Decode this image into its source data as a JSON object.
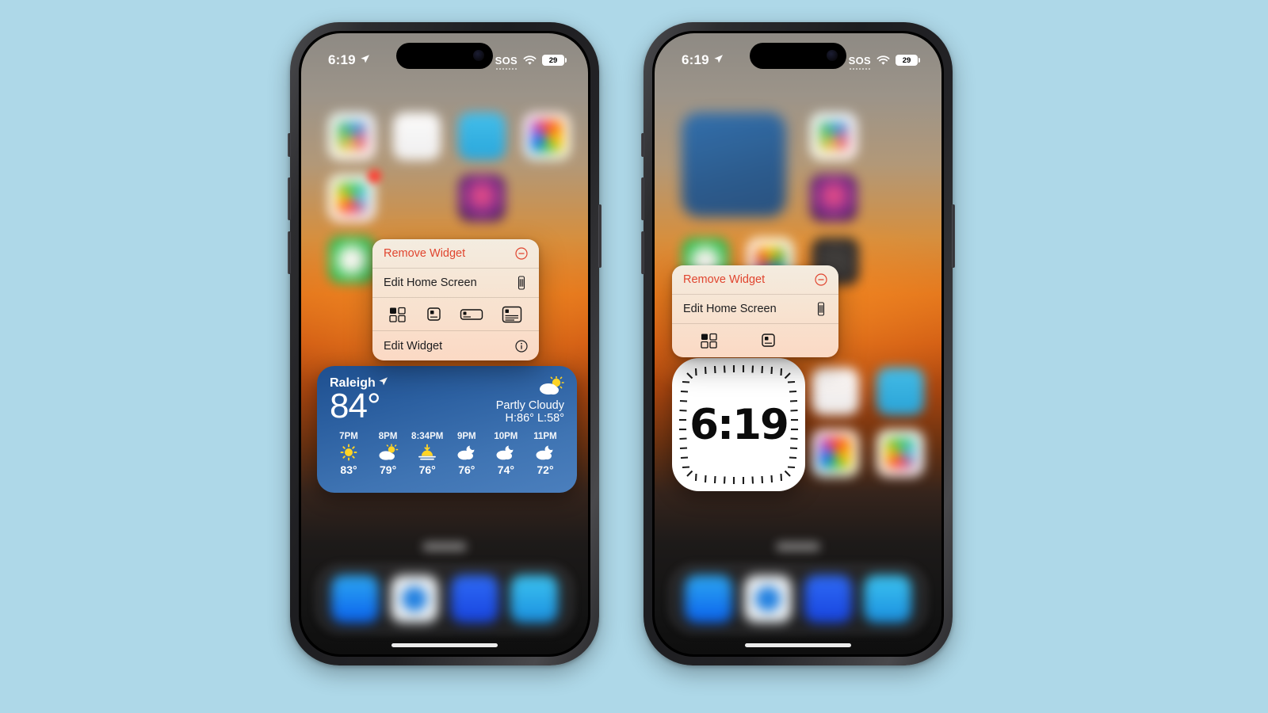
{
  "page": {
    "background_color": "#aed8e8"
  },
  "status_bar": {
    "time": "6:19",
    "location_icon": "location-arrow-icon",
    "sos_label": "SOS",
    "wifi_icon": "wifi-icon",
    "battery_percent": "29"
  },
  "phone_left": {
    "context_menu": {
      "remove_label": "Remove Widget",
      "remove_icon": "minus-circle-icon",
      "edit_home_label": "Edit Home Screen",
      "edit_home_icon": "iphone-jiggle-icon",
      "sizes": [
        {
          "name": "small-grid",
          "selected": true
        },
        {
          "name": "small-square",
          "selected": false
        },
        {
          "name": "medium-rectangle",
          "selected": false
        },
        {
          "name": "large-rectangle",
          "selected": false
        }
      ],
      "edit_widget_label": "Edit Widget",
      "edit_widget_icon": "info-circle-icon"
    },
    "weather_widget": {
      "city": "Raleigh",
      "location_icon": "location-arrow-icon",
      "temperature": "84°",
      "condition": "Partly Cloudy",
      "high_low": "H:86° L:58°",
      "condition_icon": "sun-behind-cloud-icon",
      "hourly": [
        {
          "time": "7PM",
          "icon": "sun-icon",
          "temp": "83°"
        },
        {
          "time": "8PM",
          "icon": "sun-behind-cloud-icon",
          "temp": "79°"
        },
        {
          "time": "8:34PM",
          "icon": "sunset-icon",
          "temp": "76°"
        },
        {
          "time": "9PM",
          "icon": "moon-behind-cloud-icon",
          "temp": "76°"
        },
        {
          "time": "10PM",
          "icon": "moon-behind-cloud-icon",
          "temp": "74°"
        },
        {
          "time": "11PM",
          "icon": "moon-behind-cloud-icon",
          "temp": "72°"
        }
      ]
    }
  },
  "phone_right": {
    "context_menu": {
      "remove_label": "Remove Widget",
      "remove_icon": "minus-circle-icon",
      "edit_home_label": "Edit Home Screen",
      "edit_home_icon": "iphone-jiggle-icon",
      "sizes": [
        {
          "name": "small-grid",
          "selected": true
        },
        {
          "name": "small-square",
          "selected": false
        }
      ]
    },
    "clock_widget": {
      "time": "6:19",
      "style": "ticked-border-white"
    }
  },
  "colors": {
    "menu_destructive": "#e0452f",
    "weather_widget_blue": "#2b5fa0",
    "accent_orange": "#e2751c"
  }
}
